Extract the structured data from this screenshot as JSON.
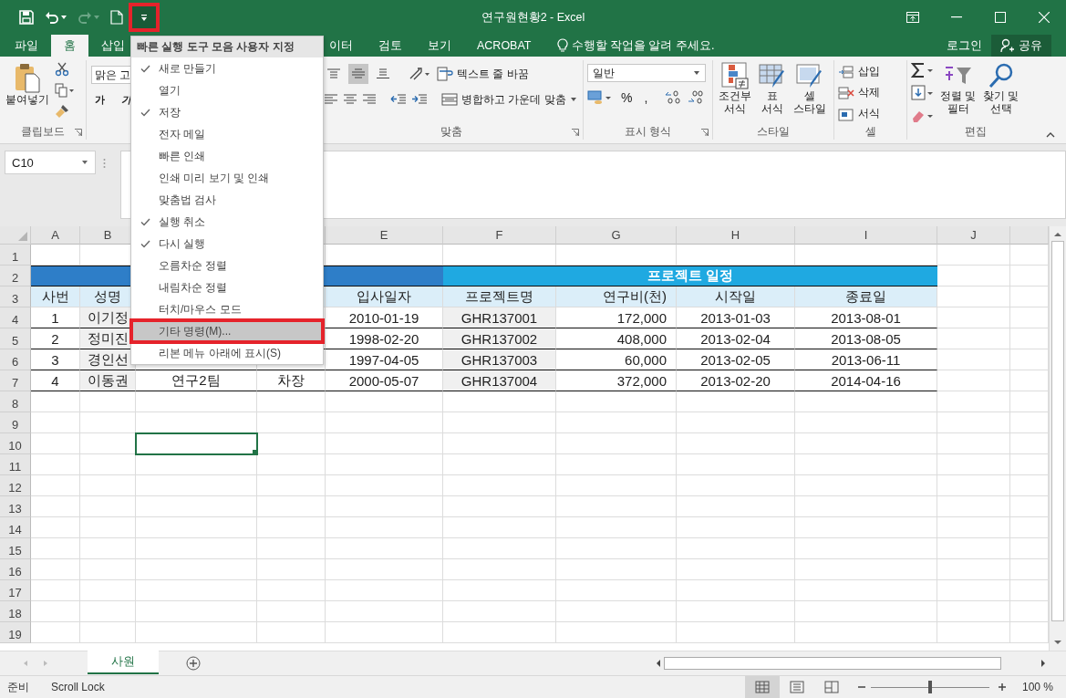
{
  "window": {
    "title": "연구원현황2 - Excel"
  },
  "quick_access": [
    {
      "kind": "save",
      "disabled": false,
      "annotated": false
    },
    {
      "kind": "undo",
      "disabled": false,
      "annotated": false
    },
    {
      "kind": "redo",
      "disabled": true,
      "annotated": false
    },
    {
      "kind": "new",
      "disabled": false,
      "annotated": false
    },
    {
      "kind": "customize",
      "disabled": false,
      "annotated": true
    }
  ],
  "tabs": [
    {
      "label": "파일",
      "selected": false
    },
    {
      "label": "홈",
      "selected": true
    },
    {
      "label": "삽입",
      "selected": false
    },
    {
      "label": "이터",
      "selected": false
    },
    {
      "label": "검토",
      "selected": false
    },
    {
      "label": "보기",
      "selected": false
    },
    {
      "label": "ACROBAT",
      "selected": false
    }
  ],
  "tell_me": "수행할 작업을 알려 주세요.",
  "sign_in": "로그인",
  "share": "공유",
  "ribbon": {
    "clipboard": {
      "label": "클립보드",
      "paste": "붙여넣기"
    },
    "font": {
      "name": "맑은 고",
      "bold": "가",
      "italic": "가"
    },
    "alignment": {
      "label": "맞춤",
      "wrap": "텍스트 줄 바꿈",
      "merge": "병합하고 가운데 맞춤",
      "vertical": [
        {
          "kind": "top",
          "selected": false
        },
        {
          "kind": "middle",
          "selected": true
        },
        {
          "kind": "bottom",
          "selected": false
        }
      ]
    },
    "number": {
      "label": "표시 형식",
      "format": "일반",
      "percent": "%",
      "comma": ","
    },
    "styles": {
      "label": "스타일",
      "conditional": [
        "조건부",
        "서식"
      ],
      "table": [
        "표",
        "서식"
      ],
      "cell": [
        "셀",
        "스타일"
      ]
    },
    "cells": {
      "label": "셀",
      "insert": "삽입",
      "delete": "삭제",
      "format": "서식"
    },
    "editing": {
      "label": "편집",
      "sort": [
        "정렬 및",
        "필터"
      ],
      "find": [
        "찾기 및",
        "선택"
      ]
    }
  },
  "name_box": "C10",
  "sheet": {
    "columns": [
      "A",
      "B",
      null,
      null,
      "E",
      "F",
      "G",
      "H",
      "I",
      "J"
    ],
    "rows": [
      {
        "number": "1"
      },
      {
        "number": "2",
        "kind": "band",
        "bands": [
          {
            "color": "#2e7ec8"
          },
          {
            "color": "#1fa9e1",
            "text": "프로젝트 일정"
          }
        ]
      },
      {
        "number": "3",
        "kind": "header",
        "cells": [
          "사번",
          "성명",
          null,
          null,
          "입사일자",
          "프로젝트명",
          "연구비(천)",
          "시작일",
          "종료일"
        ]
      },
      {
        "number": "4",
        "kind": "data",
        "cells": [
          "1",
          "이기정",
          null,
          null,
          "2010-01-19",
          "GHR137001",
          "172,000",
          "2013-01-03",
          "2013-08-01"
        ]
      },
      {
        "number": "5",
        "kind": "data",
        "cells": [
          "2",
          "정미진",
          null,
          null,
          "1998-02-20",
          "GHR137002",
          "408,000",
          "2013-02-04",
          "2013-08-05"
        ]
      },
      {
        "number": "6",
        "kind": "data",
        "cells": [
          "3",
          "경인선",
          null,
          null,
          "1997-04-05",
          "GHR137003",
          "60,000",
          "2013-02-05",
          "2013-06-11"
        ]
      },
      {
        "number": "7",
        "kind": "data",
        "cells": [
          "4",
          "이동권",
          "연구2팀",
          "차장",
          "2000-05-07",
          "GHR137004",
          "372,000",
          "2013-02-20",
          "2014-04-16"
        ]
      },
      {
        "number": "8"
      },
      {
        "number": "9"
      },
      {
        "number": "10",
        "cells": [
          null,
          null,
          {
            "selected": true
          }
        ]
      },
      {
        "number": "11"
      },
      {
        "number": "12"
      },
      {
        "number": "13"
      },
      {
        "number": "14"
      },
      {
        "number": "15"
      },
      {
        "number": "16"
      },
      {
        "number": "17"
      },
      {
        "number": "18"
      },
      {
        "number": "19"
      }
    ]
  },
  "sheet_tabs": [
    {
      "label": "사원",
      "selected": true
    }
  ],
  "status": [
    "준비",
    "Scroll Lock"
  ],
  "views": [
    {
      "kind": "normal",
      "selected": true
    },
    {
      "kind": "page_layout",
      "selected": false
    },
    {
      "kind": "page_break",
      "selected": false
    }
  ],
  "zoom": {
    "level": 0.5,
    "reading": "100 %"
  },
  "menu": {
    "title": "빠른 실행 도구 모음 사용자 지정",
    "items": [
      {
        "label": "새로 만들기",
        "checked": true,
        "selected": false,
        "annotated": false
      },
      {
        "label": "열기",
        "checked": false,
        "selected": false,
        "annotated": false
      },
      {
        "label": "저장",
        "checked": true,
        "selected": false,
        "annotated": false
      },
      {
        "label": "전자 메일",
        "checked": false,
        "selected": false,
        "annotated": false
      },
      {
        "label": "빠른 인쇄",
        "checked": false,
        "selected": false,
        "annotated": false
      },
      {
        "label": "인쇄 미리 보기 및 인쇄",
        "checked": false,
        "selected": false,
        "annotated": false
      },
      {
        "label": "맞춤법 검사",
        "checked": false,
        "selected": false,
        "annotated": false
      },
      {
        "label": "실행 취소",
        "checked": true,
        "selected": false,
        "annotated": false
      },
      {
        "label": "다시 실행",
        "checked": true,
        "selected": false,
        "annotated": false
      },
      {
        "label": "오름차순 정렬",
        "checked": false,
        "selected": false,
        "annotated": false
      },
      {
        "label": "내림차순 정렬",
        "checked": false,
        "selected": false,
        "annotated": false
      },
      {
        "label": "터치/마우스 모드",
        "checked": false,
        "selected": false,
        "annotated": false
      },
      {
        "label": "기타 명령(M)...",
        "checked": false,
        "selected": true,
        "annotated": true
      },
      {
        "label": "리본 메뉴 아래에 표시(S)",
        "checked": false,
        "selected": false,
        "annotated": false
      }
    ]
  }
}
